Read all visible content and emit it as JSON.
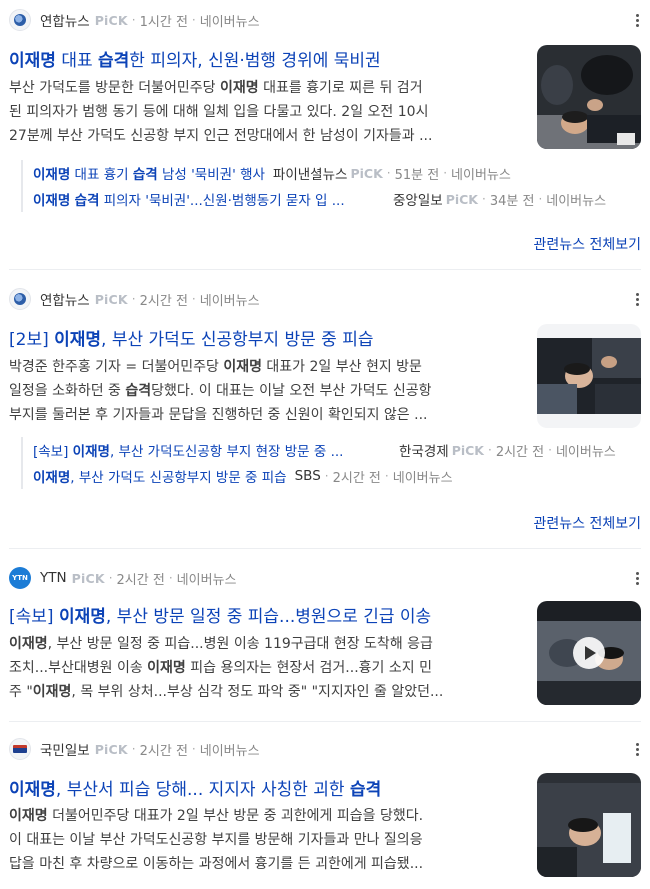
{
  "articles": [
    {
      "press": "연합뉴스",
      "pick": "PiCK",
      "time": "1시간 전",
      "portal": "네이버뉴스",
      "title_bold": "이재명",
      "title_mid": " 대표 ",
      "title_bold2": "습격",
      "title_rest": "한 피의자, 신원·범행 경위에 묵비권",
      "desc_lines": [
        [
          "부산 가덕도를 방문한 더불어민주당 ",
          "이재명",
          " 대표를 흉기로 찌른 뒤 검거"
        ],
        [
          "된 피의자가 범행 동기 등에 대해 일체 입을 다물고 있다. 2일 오전 10시",
          "",
          ""
        ],
        [
          "27분께 부산 가덕도 신공항 부지 인근 전망대에서 한 남성이 기자들과 ...",
          "",
          ""
        ]
      ],
      "sub": [
        {
          "bold": "이재명",
          "text1": " 대표 흉기 ",
          "bold2": "습격",
          "text2": " 남성 '묵비권' 행사",
          "press": "파이낸셜뉴스",
          "pick": "PiCK",
          "time": "51분 전",
          "portal": "네이버뉴스"
        },
        {
          "bold": "이재명",
          "text1": " ",
          "bold2": "습격",
          "text2": " 피의자 '묵비권'...신원·범행동기 묻자 입 ...",
          "press": "중앙일보",
          "pick": "PiCK",
          "time": "34분 전",
          "portal": "네이버뉴스"
        }
      ],
      "related": "관련뉴스 전체보기"
    },
    {
      "press": "연합뉴스",
      "pick": "PiCK",
      "time": "2시간 전",
      "portal": "네이버뉴스",
      "title_pre": "[2보] ",
      "title_bold": "이재명",
      "title_rest": ", 부산 가덕도 신공항부지 방문 중 피습",
      "desc_lines": [
        [
          "박경준 한주홍 기자 = 더불어민주당 ",
          "이재명",
          " 대표가 2일 부산 현지 방문"
        ],
        [
          "일정을 소화하던 중 ",
          "습격",
          "당했다. 이 대표는 이날 오전 부산 가덕도 신공항"
        ],
        [
          "부지를 둘러본 후 기자들과 문답을 진행하던 중 신원이 확인되지 않은 ...",
          "",
          ""
        ]
      ],
      "sub": [
        {
          "pre": "[속보] ",
          "bold": "이재명",
          "text1": ", 부산 가덕도신공항 부지 현장 방문 중 ...",
          "press": "한국경제",
          "pick": "PiCK",
          "time": "2시간 전",
          "portal": "네이버뉴스"
        },
        {
          "pre": "",
          "bold": "이재명",
          "text1": ", 부산 가덕도 신공항부지 방문 중 피습",
          "press": "SBS",
          "pick": "",
          "time": "2시간 전",
          "portal": "네이버뉴스"
        }
      ],
      "related": "관련뉴스 전체보기"
    },
    {
      "press": "YTN",
      "logo_text": "YTN",
      "pick": "PiCK",
      "time": "2시간 전",
      "portal": "네이버뉴스",
      "title_pre": "[속보] ",
      "title_bold": "이재명",
      "title_rest": ", 부산 방문 일정 중 피습...병원으로 긴급 이송",
      "desc_lines": [
        [
          "",
          "이재명",
          ", 부산 방문 일정 중 피습...병원 이송 119구급대 현장 도착해 응급"
        ],
        [
          "조치...부산대병원 이송 ",
          "이재명",
          " 피습 용의자는 현장서 검거...흉기 소지 민"
        ],
        [
          "주 \"",
          "이재명",
          ", 목 부위 상처...부상 심각 정도 파악 중\" \"지지자인 줄 알았던..."
        ]
      ]
    },
    {
      "press": "국민일보",
      "pick": "PiCK",
      "time": "2시간 전",
      "portal": "네이버뉴스",
      "title_bold": "이재명",
      "title_rest": ", 부산서 피습 당해... 지지자 사칭한 괴한 ",
      "title_bold2": "습격",
      "desc_lines": [
        [
          "",
          "이재명",
          " 더불어민주당 대표가 2일 부산 방문 중 괴한에게 피습을 당했다."
        ],
        [
          "이 대표는 이날 부산 가덕도신공항 부지를 방문해 기자들과 만나 질의응",
          "",
          ""
        ],
        [
          "답을 마친 후 차량으로 이동하는 과정에서 흉기를 든 괴한에게 피습됐...",
          "",
          ""
        ]
      ]
    }
  ],
  "icons": {
    "more": "more-vertical-icon",
    "play": "play-icon"
  }
}
